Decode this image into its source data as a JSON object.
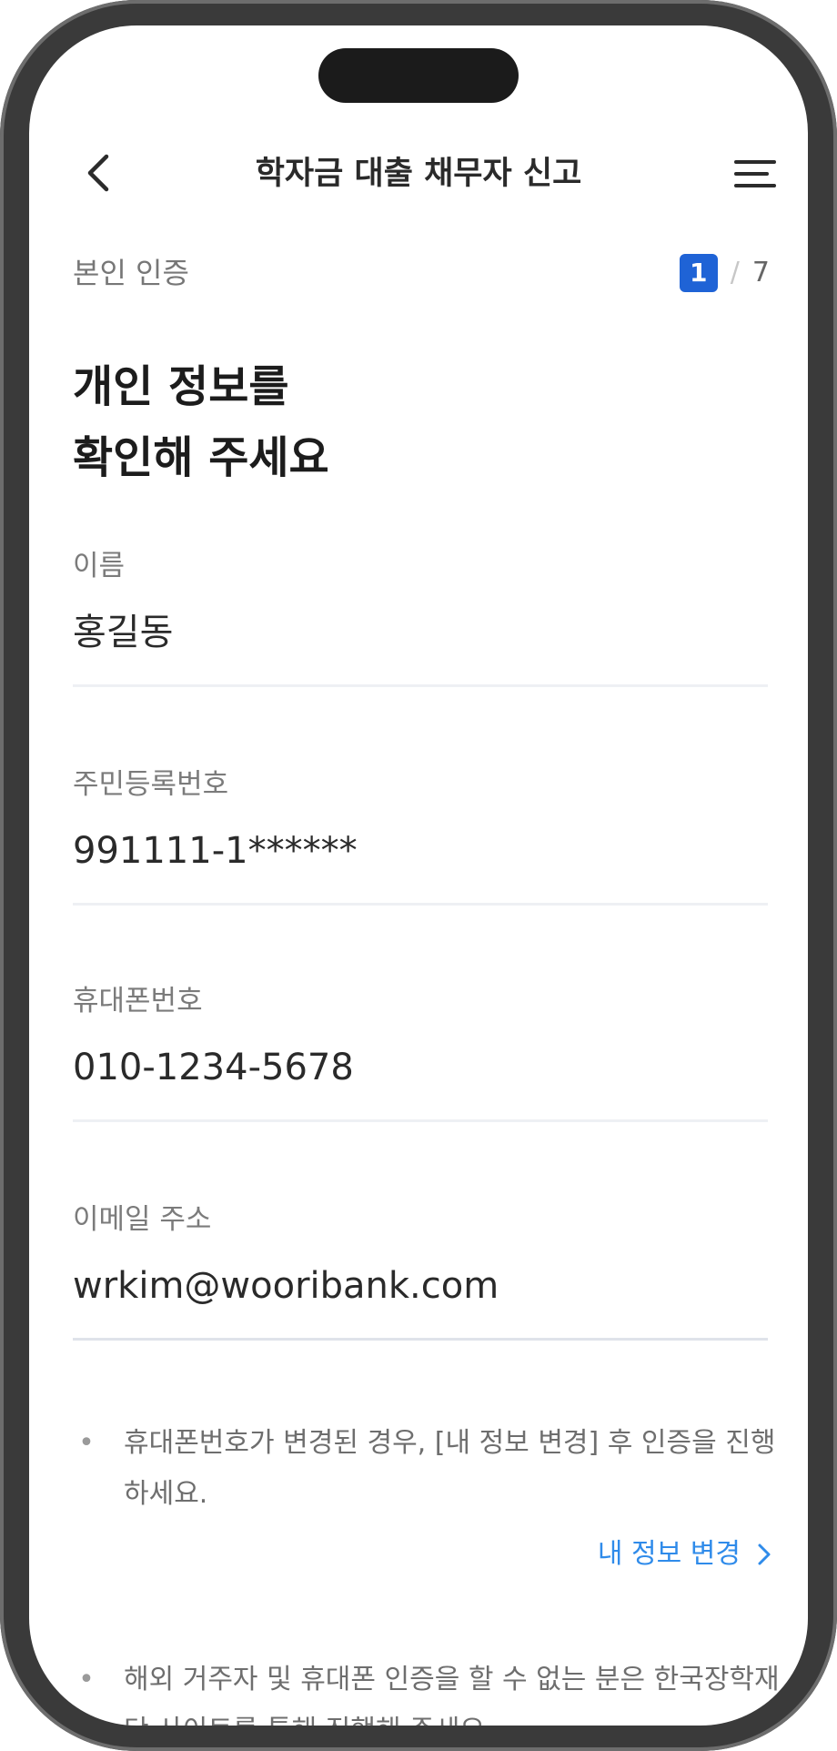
{
  "header": {
    "title": "학자금 대출 채무자 신고"
  },
  "step": {
    "label": "본인 인증",
    "current": "1",
    "separator": "/",
    "total": "7"
  },
  "heading": {
    "line1": "개인 정보를",
    "line2": "확인해 주세요"
  },
  "fields": [
    {
      "label": "이름",
      "value": "홍길동"
    },
    {
      "label": "주민등록번호",
      "value": "991111-1******"
    },
    {
      "label": "휴대폰번호",
      "value": "010-1234-5678"
    },
    {
      "label": "이메일 주소",
      "value": "wrkim@wooribank.com"
    }
  ],
  "notes": [
    {
      "bullet": "•",
      "text": "휴대폰번호가 변경된 경우, [내 정보 변경] 후 인증을 진행하세요."
    },
    {
      "bullet": "•",
      "text": "해외 거주자 및 휴대폰 인증을 할 수 없는 분은 한국장학재단 사이트를 통해 진행해 주세요."
    }
  ],
  "link": {
    "label": "내 정보 변경"
  },
  "icons": {
    "back": "chevron-left-icon",
    "menu": "hamburger-menu-icon",
    "link_arrow": "chevron-right-icon"
  },
  "colors": {
    "accent": "#1f63d6",
    "link": "#2f8bea"
  }
}
